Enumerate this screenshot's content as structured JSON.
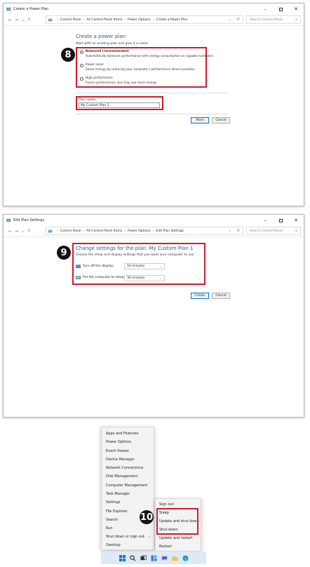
{
  "window1": {
    "title": "Create a Power Plan",
    "breadcrumb": [
      "Control Panel",
      "All Control Panel Items",
      "Power Options",
      "Create a Power Plan"
    ],
    "search_placeholder": "Search Control Panel",
    "heading": "Create a power plan",
    "subtitle": "Start with an existing plan and give it a name.",
    "step_badge": "8",
    "options": [
      {
        "label": "Balanced (recommended)",
        "description": "Automatically balances performance with energy consumption on capable hardware.",
        "selected": true
      },
      {
        "label": "Power saver",
        "description": "Saves energy by reducing your computer's performance where possible.",
        "selected": false
      },
      {
        "label": "High performance",
        "description": "Favors performance, but may use more energy.",
        "selected": false
      }
    ],
    "plan_name_label": "Plan name:",
    "plan_name_value": "My Custom Plan 1",
    "next_label": "Next",
    "cancel_label": "Cancel"
  },
  "window2": {
    "title": "Edit Plan Settings",
    "breadcrumb": [
      "Control Panel",
      "All Control Panel Items",
      "Power Options",
      "Edit Plan Settings"
    ],
    "search_placeholder": "Search Control Panel",
    "step_badge": "9",
    "heading": "Change settings for the plan: My Custom Plan 1",
    "subtitle": "Choose the sleep and display settings that you want your computer to use.",
    "settings": [
      {
        "label": "Turn off the display:",
        "value": "10 minutes",
        "icon": "monitor-icon"
      },
      {
        "label": "Put the computer to sleep:",
        "value": "30 minutes",
        "icon": "sleep-icon"
      }
    ],
    "create_label": "Create",
    "cancel_label": "Cancel"
  },
  "context_menu": {
    "step_badge": "10",
    "items": [
      "Apps and Features",
      "Power Options",
      "Event Viewer",
      "Device Manager",
      "Network Connections",
      "Disk Management",
      "Computer Management",
      "Task Manager",
      "Settings",
      "File Explorer",
      "Search",
      "Run",
      "Shut down or sign out",
      "Desktop"
    ],
    "submenu": [
      "Sign out",
      "Sleep",
      "Update and shut down",
      "Shut down",
      "Update and restart",
      "Restart"
    ]
  },
  "colors": {
    "accent": "#1e5aa8",
    "highlight_red": "#d3192e",
    "badge_bg": "#141414"
  }
}
